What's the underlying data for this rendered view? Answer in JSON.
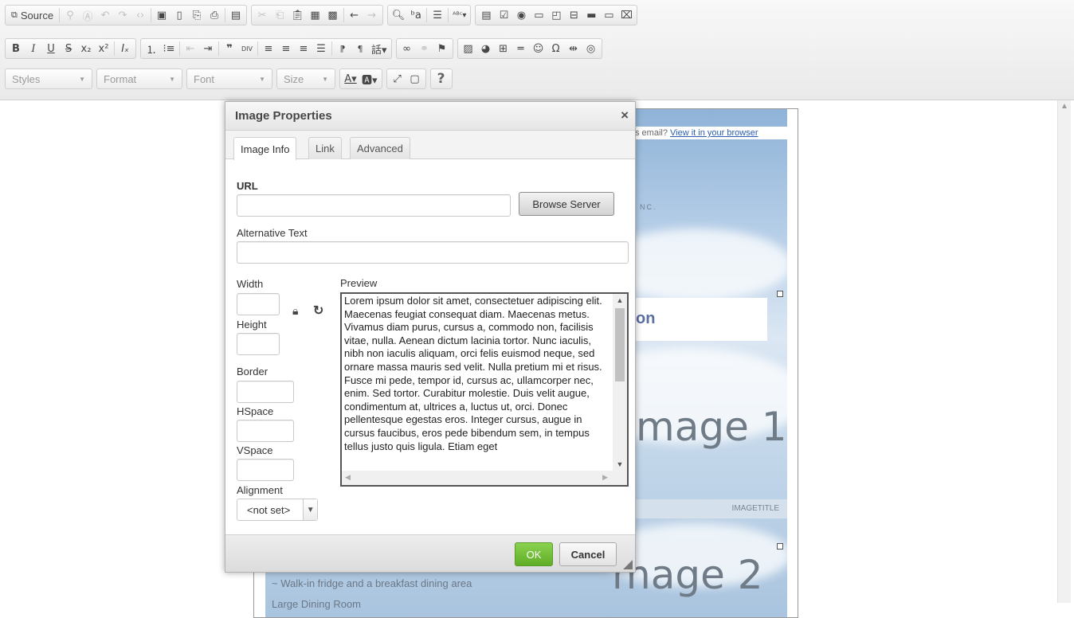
{
  "toolbar": {
    "source_label": "Source",
    "combos": {
      "styles": "Styles",
      "format": "Format",
      "font": "Font",
      "size": "Size"
    },
    "help_label": "?"
  },
  "document": {
    "view_prompt": "s email? ",
    "view_link": "View it in your browser",
    "inc_text": "NC.",
    "heading_fragment": "on",
    "image1_text": "mage 1",
    "image_title": "IMAGETITLE",
    "image2_text": "mage 2",
    "walkin_text": "~ Walk-in fridge and a breakfast dining area",
    "dining_text": "Large Dining Room"
  },
  "dialog": {
    "title": "Image Properties",
    "close_glyph": "×",
    "tabs": [
      "Image Info",
      "Link",
      "Advanced"
    ],
    "url_label": "URL",
    "url_value": "",
    "browse_label": "Browse Server",
    "alt_label": "Alternative Text",
    "alt_value": "",
    "width_label": "Width",
    "height_label": "Height",
    "border_label": "Border",
    "hspace_label": "HSpace",
    "vspace_label": "VSpace",
    "alignment_label": "Alignment",
    "alignment_value": "<not set>",
    "preview_label": "Preview",
    "preview_text": "Lorem ipsum dolor sit amet, consectetuer adipiscing elit. Maecenas feugiat consequat diam. Maecenas metus. Vivamus diam purus, cursus a, commodo non, facilisis vitae, nulla. Aenean dictum lacinia tortor. Nunc iaculis, nibh non iaculis aliquam, orci felis euismod neque, sed ornare massa mauris sed velit. Nulla pretium mi et risus. Fusce mi pede, tempor id, cursus ac, ullamcorper nec, enim. Sed tortor. Curabitur molestie. Duis velit augue, condimentum at, ultrices a, luctus ut, orci. Donec pellentesque egestas eros. Integer cursus, augue in cursus faucibus, eros pede bibendum sem, in tempus tellus justo quis ligula. Etiam eget",
    "ok_label": "OK",
    "cancel_label": "Cancel"
  },
  "colors": {
    "ok_green": "#6cbf31",
    "link_blue": "#2a5db0"
  }
}
